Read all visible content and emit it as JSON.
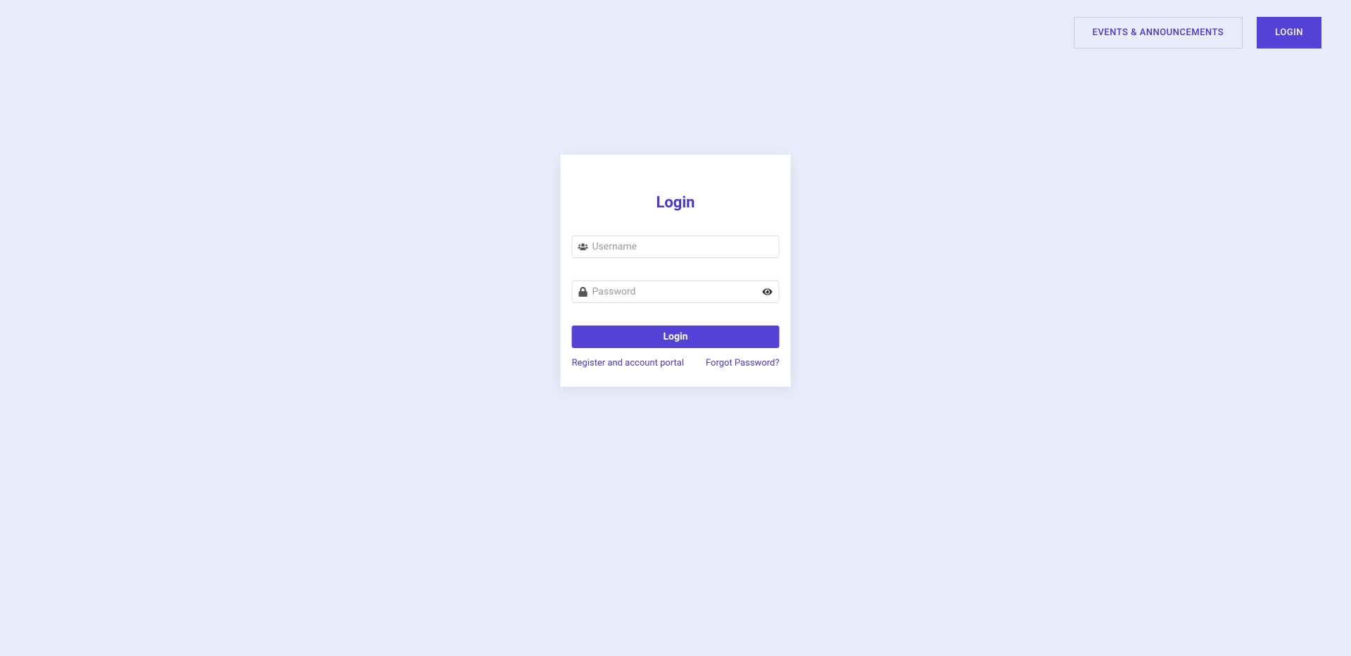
{
  "nav": {
    "events_label": "EVENTS & ANNOUNCEMENTS",
    "login_label": "LOGIN"
  },
  "login": {
    "title": "Login",
    "username_placeholder": "Username",
    "password_placeholder": "Password",
    "submit_label": "Login",
    "register_link": "Register and account portal",
    "forgot_link": "Forgot Password?"
  }
}
